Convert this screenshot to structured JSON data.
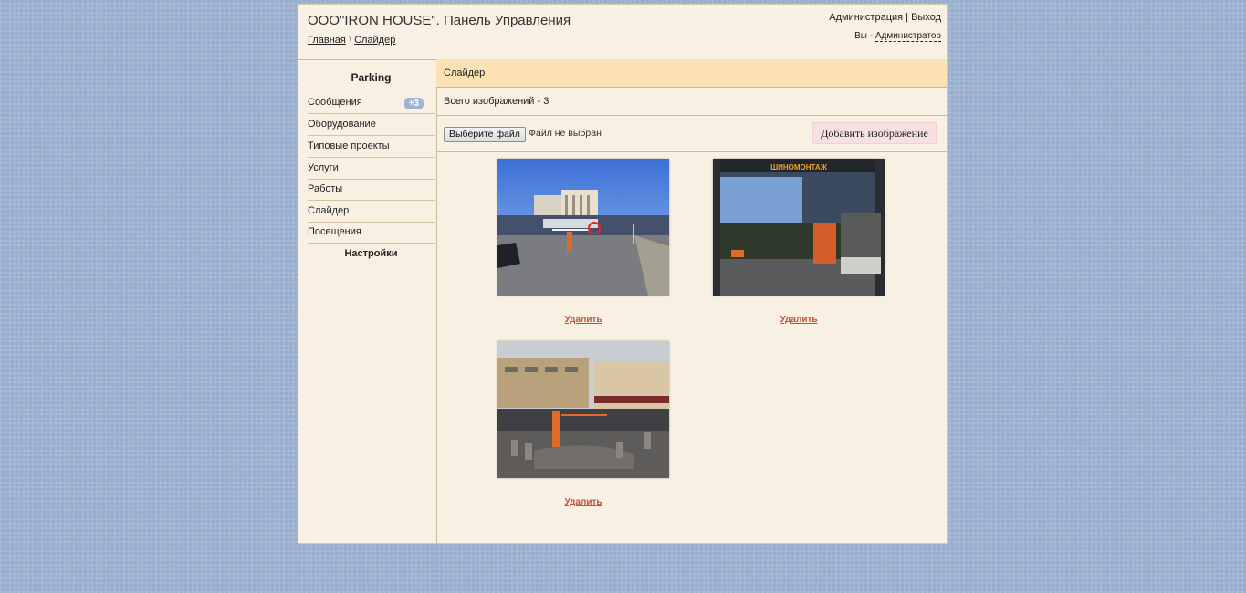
{
  "header": {
    "title": "ООО\"IRON HOUSE\". Панель Управления",
    "breadcrumb": {
      "home": "Главная",
      "separator": "\\",
      "current": "Слайдер"
    },
    "links": {
      "admin": "Администрация",
      "separator": "|",
      "logout": "Выход"
    },
    "user_prefix": "Вы -",
    "user_name": "Администратор"
  },
  "sidebar": {
    "section_title": "Parking",
    "items": [
      {
        "label": "Сообщения",
        "badge": "+3"
      },
      {
        "label": "Оборудование"
      },
      {
        "label": "Типовые проекты"
      },
      {
        "label": "Услуги"
      },
      {
        "label": "Работы"
      },
      {
        "label": "Слайдер"
      },
      {
        "label": "Посещения"
      }
    ],
    "settings_title": "Настройки"
  },
  "main": {
    "panel_title": "Слайдер",
    "count_text": "Всего изображений - 3",
    "file_button": "Выберите файл",
    "file_status": "Файл не выбран",
    "add_button": "Добавить изображение",
    "images": [
      {
        "delete_label": "Удалить"
      },
      {
        "delete_label": "Удалить",
        "sign_text": "ШИНОМОНТАЖ"
      },
      {
        "delete_label": "Удалить"
      }
    ]
  },
  "colors": {
    "page_background": "#97aecf",
    "panel_background": "#f8f0e3",
    "title_bar": "#fbe1b4",
    "add_button": "#f8dfe2",
    "delete_link": "#c0533d",
    "badge": "#9fb4d0"
  }
}
